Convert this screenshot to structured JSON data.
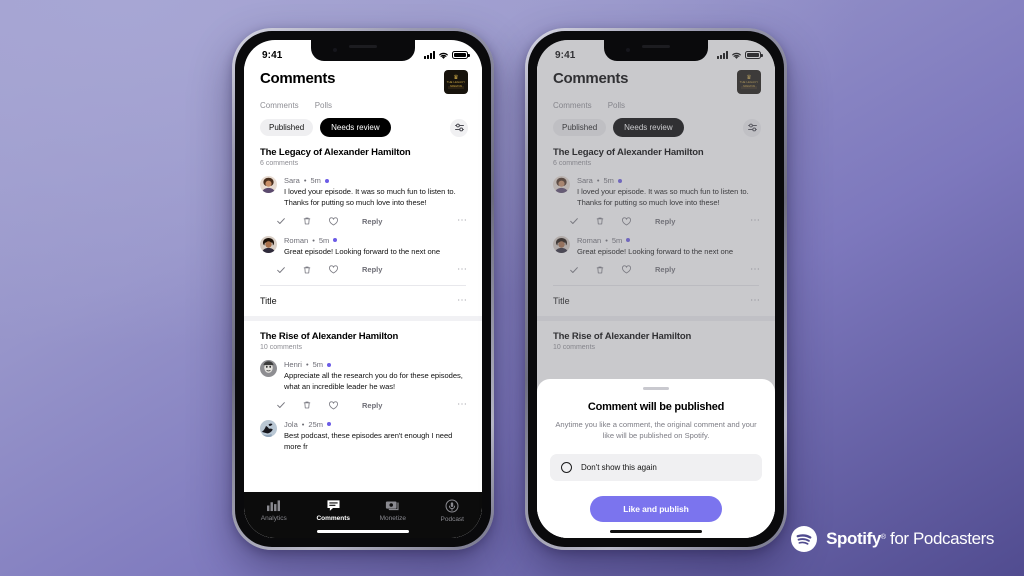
{
  "brand": {
    "name_bold": "Spotify",
    "registered": "®",
    "name_rest": " for Podcasters",
    "logo_icon": "spotify-logo-icon",
    "colors": {
      "accent": "#7b74ee",
      "bg_light": "#a2a1cf",
      "bg_dark": "#514c90"
    }
  },
  "phone": {
    "status_bar": {
      "time": "9:41",
      "cellular_icon": "signal-bars-icon",
      "wifi_icon": "wifi-icon",
      "battery_icon": "battery-full-icon"
    },
    "header": {
      "title": "Comments",
      "cover_art": {
        "icon": "podcast-cover-art",
        "crown": "♛",
        "line1": "THE LEGACY",
        "line2": "HAMILTON"
      }
    },
    "subtabs": [
      {
        "label": "Comments",
        "active": true
      },
      {
        "label": "Polls",
        "active": false
      }
    ],
    "filters": [
      {
        "label": "Published",
        "active": false
      },
      {
        "label": "Needs review",
        "active": true
      }
    ],
    "filter_button_icon": "filter-sliders-icon",
    "sections": [
      {
        "title": "The Legacy of Alexander Hamilton",
        "count": "6 comments",
        "comments": [
          {
            "author": "Sara",
            "time": "5m",
            "unread": true,
            "text": "I loved your episode. It was so much fun to listen to. Thanks for putting so much love into these!",
            "avatar": "avatar-sara"
          },
          {
            "author": "Roman",
            "time": "5m",
            "unread": true,
            "text": "Great episode! Looking forward to the next one",
            "avatar": "avatar-roman"
          }
        ]
      },
      {
        "title": "The Rise of Alexander Hamilton",
        "count": "10 comments",
        "comments": [
          {
            "author": "Henri",
            "time": "5m",
            "unread": true,
            "text": "Appreciate all the research you do for these episodes, what an incredible leader he was!",
            "avatar": "avatar-henri"
          },
          {
            "author": "Jola",
            "time": "25m",
            "unread": true,
            "text": "Best podcast, these episodes aren't enough I need more fr",
            "avatar": "avatar-jola"
          }
        ]
      }
    ],
    "title_row": {
      "label": "Title",
      "more_icon": "ellipsis-icon"
    },
    "comment_actions": {
      "approve_icon": "checkmark-icon",
      "delete_icon": "trash-icon",
      "like_icon": "heart-icon",
      "reply_label": "Reply",
      "more_icon": "ellipsis-icon"
    },
    "separator_dot": "•",
    "tabbar": [
      {
        "label": "Analytics",
        "icon": "analytics-bars-icon",
        "active": false
      },
      {
        "label": "Comments",
        "icon": "comment-bubble-icon",
        "active": true
      },
      {
        "label": "Monetize",
        "icon": "money-icon",
        "active": false
      },
      {
        "label": "Podcast",
        "icon": "microphone-icon",
        "active": false
      }
    ]
  },
  "modal": {
    "title": "Comment will be published",
    "description": "Anytime you like a comment, the original comment and your like will be published on Spotify.",
    "checkbox_label": "Don't show this again",
    "checkbox_checked": false,
    "cta_label": "Like and publish",
    "cta_color": "#7b74ee"
  }
}
